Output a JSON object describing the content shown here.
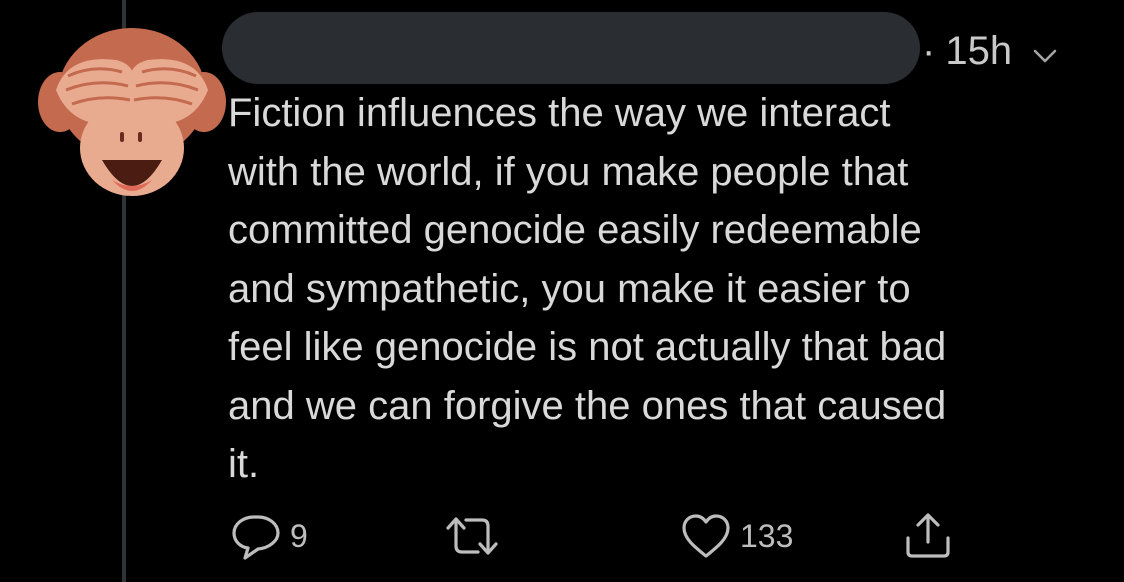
{
  "tweet": {
    "timestamp_separator": "·",
    "timestamp": "15h",
    "text": "Fiction influences the way we interact\nwith the world, if you make people that\ncommitted genocide easily redeemable\nand sympathetic, you make it easier to\nfeel like genocide is not actually that bad\nand we can forgive the ones that caused\nit.",
    "avatar_icon": "see-no-evil-monkey-icon"
  },
  "actions": {
    "reply_count": "9",
    "like_count": "133"
  },
  "colors": {
    "background": "#000000",
    "text": "#d9d9d9",
    "muted": "#bdbdbd",
    "redaction": "#2a2d31",
    "thread_line": "#2f3336"
  }
}
